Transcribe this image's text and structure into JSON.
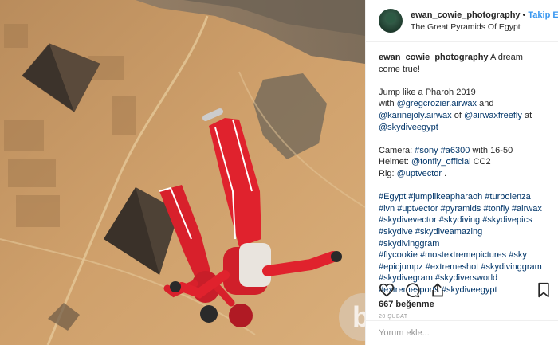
{
  "post": {
    "username": "ewan_cowie_photography",
    "follow_label": "Takip Et",
    "separator": "•",
    "location": "The Great Pyramids Of Egypt",
    "caption": {
      "username": "ewan_cowie_photography",
      "line1": "A dream come true!",
      "para2_line1": "Jump like a Pharoh 2019",
      "para2_line2_prefix": "with ",
      "para2_mention1": "@gregcrozier.airwax",
      "para2_line2_suffix": " and",
      "para2_mention2": "@karinejoly.airwax",
      "para2_line3_mid": " of ",
      "para2_mention3": "@airwaxfreefly",
      "para2_line3_suffix": " at",
      "para2_mention4": "@skydiveegypt",
      "camera_prefix": "Camera: ",
      "camera_tag": "#sony",
      "camera_model": "#a6300",
      "camera_suffix": " with 16-50",
      "helmet_prefix": "Helmet: ",
      "helmet_tag": "@tonfly_official",
      "helmet_suffix": " CC2",
      "rig_prefix": "Rig: ",
      "rig_tag": "@uptvector",
      "rig_suffix": " .",
      "hashtag_lines": [
        "#Egypt #jumplikeapharaoh #turbolenza",
        "#lvn #uptvector #pyramids #tonfly #airwax",
        "#skydivevector #skydiving #skydivepics",
        "#skydive #skydiveamazing #skydivinggram",
        "#flycookie #mostextremepictures #sky",
        "#epicjumpz #extremeshot #skydivinggram",
        "#skydivegram #skydiversworld",
        "#extremesports #skydiveegypt"
      ]
    },
    "likes": "667 beğenme",
    "date": "20 ŞUBAT",
    "comment_placeholder": "Yorum ekle..."
  },
  "icons": {
    "like": "heart-icon",
    "comment": "comment-icon",
    "share": "share-icon",
    "save": "bookmark-icon"
  },
  "colors": {
    "link": "#3897f0",
    "hashtag": "#003569",
    "muted": "#999999",
    "suit": "#d8202b",
    "sand": "#c99a64"
  }
}
